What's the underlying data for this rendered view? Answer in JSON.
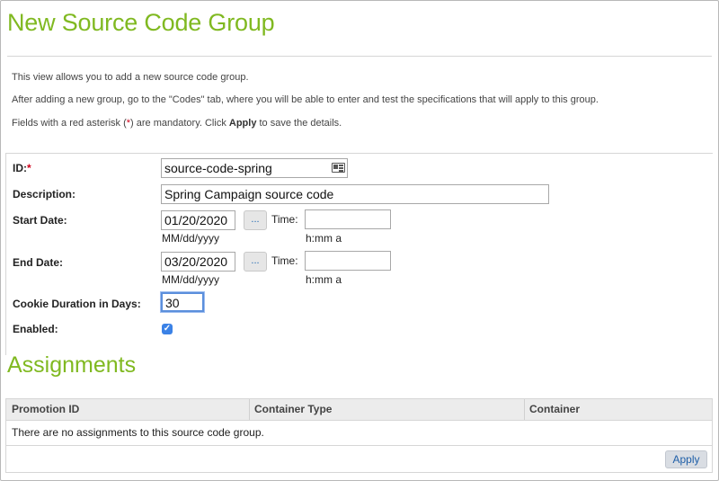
{
  "page": {
    "title": "New Source Code Group"
  },
  "intro": {
    "line1": "This view allows you to add a new source code group.",
    "line2": "After adding a new group, go to the \"Codes\" tab, where you will be able to enter and test the specifications that will apply to this group.",
    "line3_a": "Fields with a red asterisk (",
    "line3_star": "*",
    "line3_b": ") are mandatory. Click ",
    "line3_apply": "Apply",
    "line3_c": " to save the details."
  },
  "form": {
    "id": {
      "label": "ID:",
      "required_mark": "*",
      "value": "source-code-spring"
    },
    "description": {
      "label": "Description:",
      "value": "Spring Campaign source code"
    },
    "start_date": {
      "label": "Start Date:",
      "value": "01/20/2020",
      "date_hint": "MM/dd/yyyy",
      "picker_label": "...",
      "time_label": "Time:",
      "time_value": "",
      "time_hint": "h:mm a"
    },
    "end_date": {
      "label": "End Date:",
      "value": "03/20/2020",
      "date_hint": "MM/dd/yyyy",
      "picker_label": "...",
      "time_label": "Time:",
      "time_value": "",
      "time_hint": "h:mm a"
    },
    "cookie_duration": {
      "label": "Cookie Duration in Days:",
      "value": "30"
    },
    "enabled": {
      "label": "Enabled:",
      "checked": true,
      "check_glyph": "✓"
    }
  },
  "assignments": {
    "title": "Assignments",
    "columns": [
      "Promotion ID",
      "Container Type",
      "Container"
    ],
    "empty_text": "There are no assignments to this source code group.",
    "apply_label": "Apply"
  },
  "colors": {
    "brand_green": "#80b921",
    "required_red": "#d0021b",
    "link_blue": "#1a64b0",
    "focus_blue": "#5b8fdc"
  }
}
